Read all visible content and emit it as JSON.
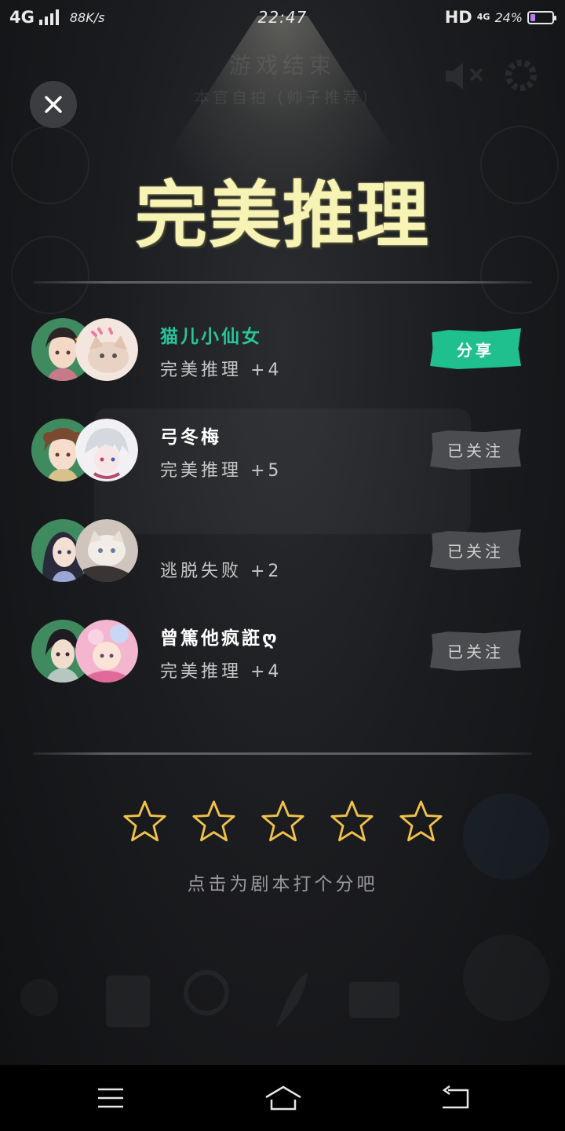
{
  "status_bar": {
    "network": "4G",
    "speed": "88K/s",
    "time": "22:47",
    "hd": "HD",
    "network_right": "4G",
    "battery_pct": "24%",
    "battery_level": 0.24
  },
  "background": {
    "title": "游戏结束",
    "subtitle": "本官自拍 (帅子推荐)"
  },
  "result": {
    "title": "完美推理"
  },
  "players": [
    {
      "name": "猫儿小仙女",
      "result": "完美推理  +4",
      "action": "分享",
      "is_self": true
    },
    {
      "name": "弓冬梅",
      "result": "完美推理  +5",
      "action": "已关注",
      "is_self": false
    },
    {
      "name": "",
      "result": "逃脱失败  +2",
      "action": "已关注",
      "is_self": false
    },
    {
      "name": "曾篤他疯誑ღ",
      "result": "完美推理  +4",
      "action": "已关注",
      "is_self": false
    }
  ],
  "rating": {
    "star_count": 5,
    "selected": 0,
    "hint": "点击为剧本打个分吧"
  },
  "colors": {
    "accent_green": "#1fbf8e",
    "title_yellow": "#f7f3b4",
    "star_gold": "#f0c24a"
  },
  "icons": {
    "close": "close-icon",
    "star": "star-outline-icon",
    "nav_menu": "menu-icon",
    "nav_home": "home-icon",
    "nav_back": "back-icon"
  }
}
